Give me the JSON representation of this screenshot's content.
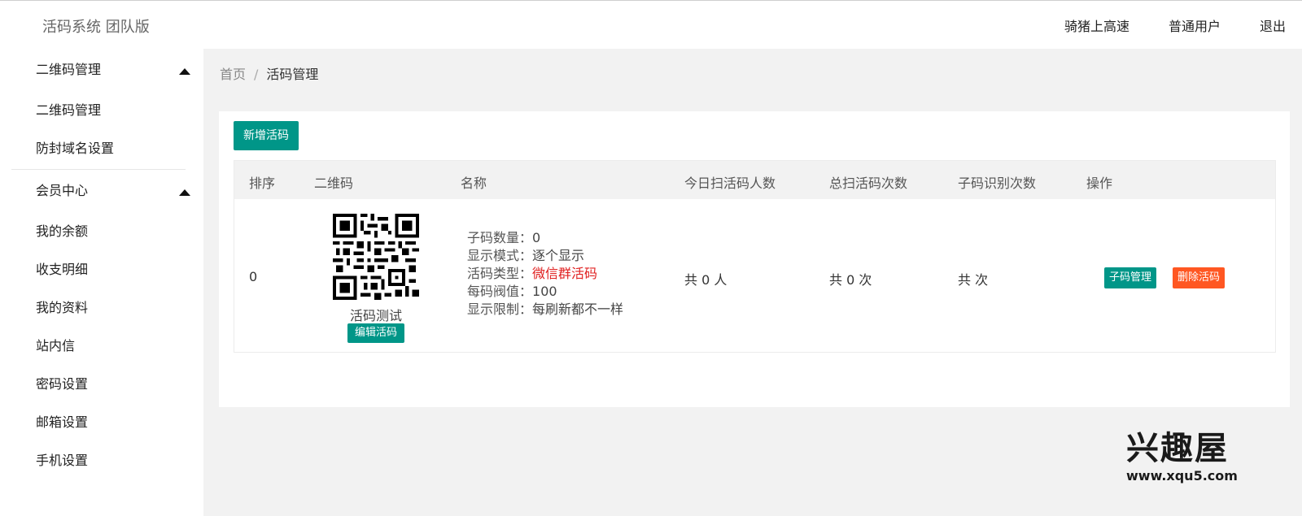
{
  "header": {
    "brand": "活码系统 团队版",
    "nav": [
      "骑猪上高速",
      "普通用户",
      "退出"
    ]
  },
  "sidebar": {
    "groups": [
      {
        "label": "二维码管理",
        "items": [
          "二维码管理",
          "防封域名设置"
        ]
      },
      {
        "label": "会员中心",
        "items": [
          "我的余额",
          "收支明细",
          "我的资料",
          "站内信",
          "密码设置",
          "邮箱设置",
          "手机设置"
        ]
      }
    ]
  },
  "breadcrumb": {
    "home": "首页",
    "sep": "/",
    "current": "活码管理"
  },
  "main": {
    "add_button": "新增活码",
    "table": {
      "headers": [
        "排序",
        "二维码",
        "名称",
        "今日扫活码人数",
        "总扫活码次数",
        "子码识别次数",
        "操作"
      ],
      "row": {
        "order": "0",
        "qr_name": "活码测试",
        "edit_button": "编辑活码",
        "info": {
          "sub_count_label": "子码数量：",
          "sub_count": "0",
          "mode_label": "显示模式：",
          "mode": "逐个显示",
          "type_label": "活码类型：",
          "type": "微信群活码",
          "threshold_label": "每码阀值：",
          "threshold": "100",
          "limit_label": "显示限制：",
          "limit": "每刷新都不一样"
        },
        "today_scans": "共 0 人",
        "total_scans": "共 0 次",
        "sub_recognitions": "共 次",
        "sub_button": "子码管理",
        "delete_button": "删除活码"
      }
    }
  },
  "watermark": {
    "title": "兴趣屋",
    "url": "www.xqu5.com"
  },
  "colors": {
    "primary": "#009688",
    "danger": "#ff5722",
    "accent_text": "#e02020"
  }
}
